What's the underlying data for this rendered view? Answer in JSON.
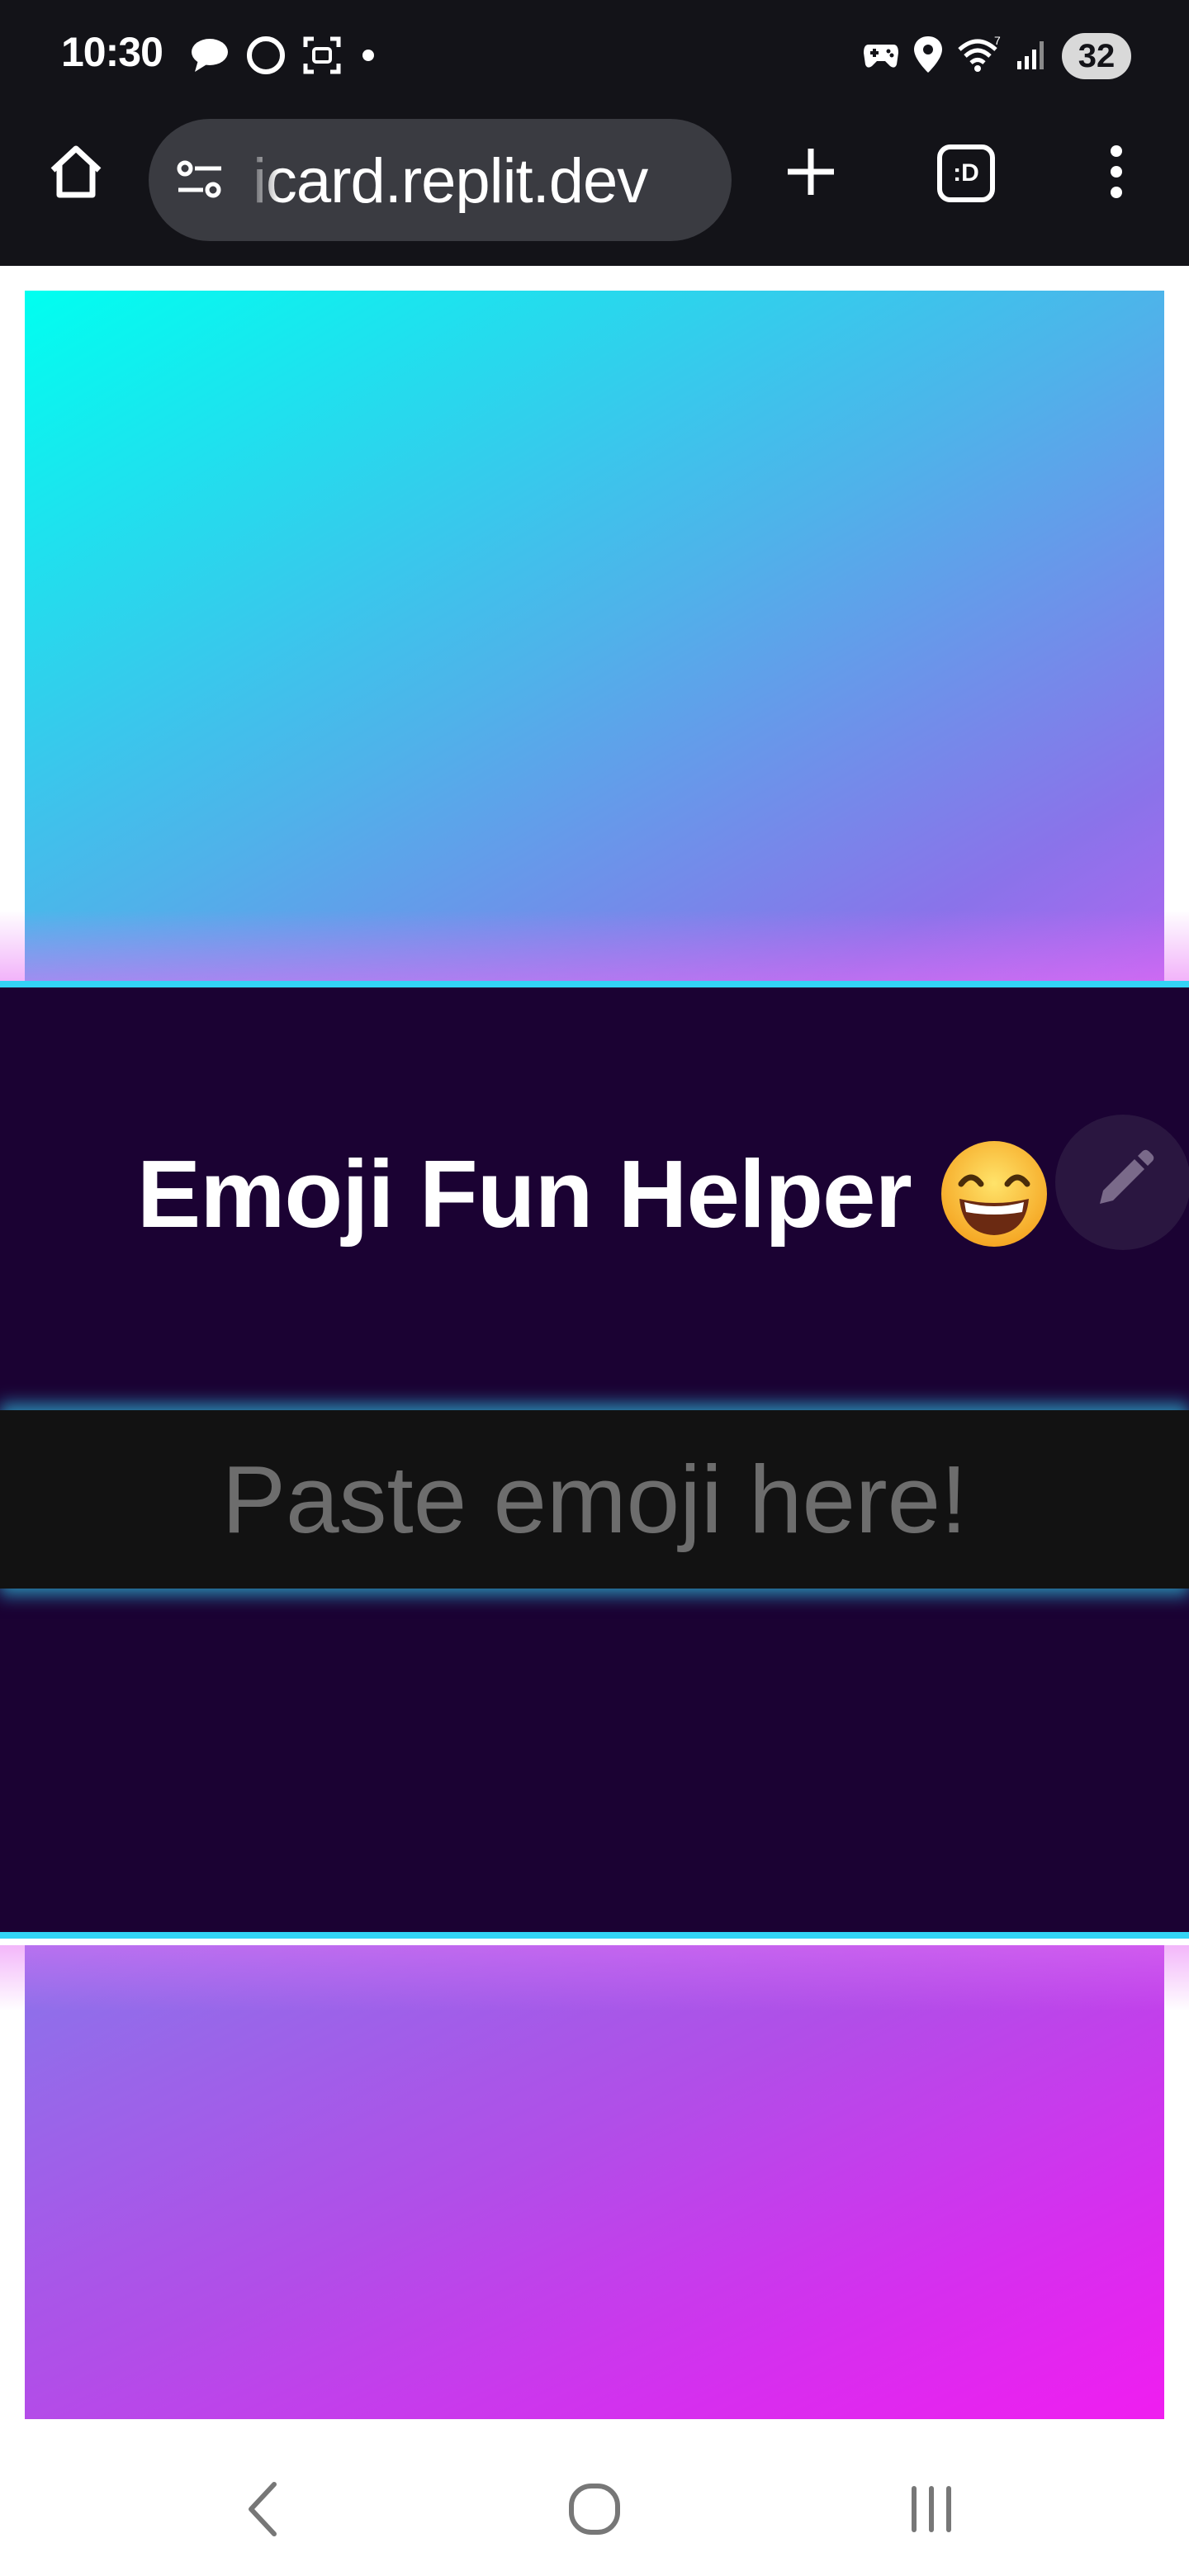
{
  "status_bar": {
    "time": "10:30",
    "battery": "32",
    "left_icons": [
      "chat-bubble-icon",
      "threads-icon",
      "screenshot-icon",
      "dot-icon"
    ],
    "right_icons": [
      "gamepad-icon",
      "location-icon",
      "wifi-icon",
      "signal-icon"
    ]
  },
  "browser": {
    "url": "icard.replit.dev",
    "url_hidden_prefix": "i",
    "tab_switcher_label": ":D",
    "icons": [
      "home-icon",
      "site-settings-icon",
      "new-tab-icon",
      "tab-switcher-icon",
      "more-vert-icon"
    ]
  },
  "app": {
    "title": "Emoji Fun Helper",
    "title_emoji": "grinning-face-with-smiling-eyes",
    "input": {
      "value": "",
      "placeholder": "Paste emoji here!"
    },
    "colors": {
      "panel_bg": "#1b0233",
      "accent_cyan": "#33d4f5",
      "input_bg": "#121212",
      "gradient_top": [
        "#00fff0",
        "#b066f0"
      ],
      "gradient_bottom": [
        "#8a74ea",
        "#f01df0"
      ]
    }
  },
  "nav": {
    "icons": [
      "back-icon",
      "home-circle-icon",
      "recents-icon"
    ]
  }
}
